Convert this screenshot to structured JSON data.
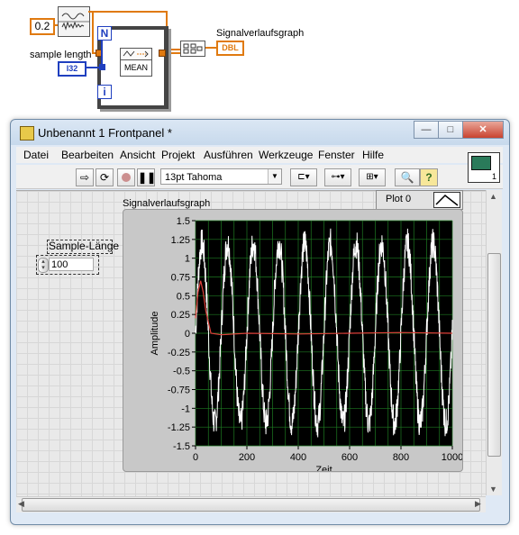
{
  "block_diagram": {
    "constant_value": "0.2",
    "sample_length_label": "sample length",
    "i32_terminal": "I32",
    "loop_count_terminal": "N",
    "iteration_terminal": "i",
    "mean_vi_label": "MEAN",
    "dbl_terminal": "DBL",
    "graph_terminal_label": "Signalverlaufsgraph"
  },
  "window": {
    "title": "Unbenannt 1 Frontpanel *",
    "buttons": {
      "minimize": "—",
      "maximize": "□",
      "close": "✕"
    }
  },
  "menu": [
    "Datei",
    "Bearbeiten",
    "Ansicht",
    "Projekt",
    "Ausführen",
    "Werkzeuge",
    "Fenster",
    "Hilfe"
  ],
  "toolbar": {
    "font_select": "13pt Tahoma",
    "icons": [
      "run-arrow-icon",
      "run-continuously-icon",
      "abort-icon",
      "pause-icon",
      "align-icon",
      "distribute-icon",
      "resize-icon",
      "search-icon",
      "help-icon"
    ],
    "connector_pane_number": "1"
  },
  "control": {
    "label": "Sample-Länge",
    "value": "100"
  },
  "graph": {
    "label": "Signalverlaufsgraph",
    "legend_plot": "Plot 0"
  },
  "chart_data": {
    "type": "line",
    "xlabel": "Zeit",
    "ylabel": "Amplitude",
    "xlim": [
      0,
      1000
    ],
    "ylim": [
      -1.5,
      1.5
    ],
    "xticks": [
      "0",
      "200",
      "400",
      "600",
      "800",
      "1000"
    ],
    "yticks": [
      "1.5",
      "1.25",
      "1",
      "0.75",
      "0.5",
      "0.25",
      "0",
      "-0.25",
      "-0.5",
      "-0.75",
      "-1",
      "-1.25",
      "-1.5"
    ],
    "grid": true,
    "series": [
      {
        "name": "Plot 0",
        "color": "#ffffff",
        "kind": "noisy sine",
        "amplitude": 1.2,
        "period": 100,
        "noise": 0.2,
        "points": 1000
      },
      {
        "color": "#e0403a",
        "kind": "running mean",
        "x": [
          0,
          10,
          20,
          30,
          40,
          60,
          100,
          200,
          400,
          600,
          800,
          1000
        ],
        "y": [
          0.2,
          0.55,
          0.7,
          0.55,
          0.3,
          0.0,
          -0.02,
          0.0,
          -0.01,
          0.0,
          0.01,
          0.0
        ]
      }
    ],
    "colors": {
      "plot_bg": "#000000",
      "grid": "#1e7a22",
      "frame": "#c8c8c8"
    }
  }
}
